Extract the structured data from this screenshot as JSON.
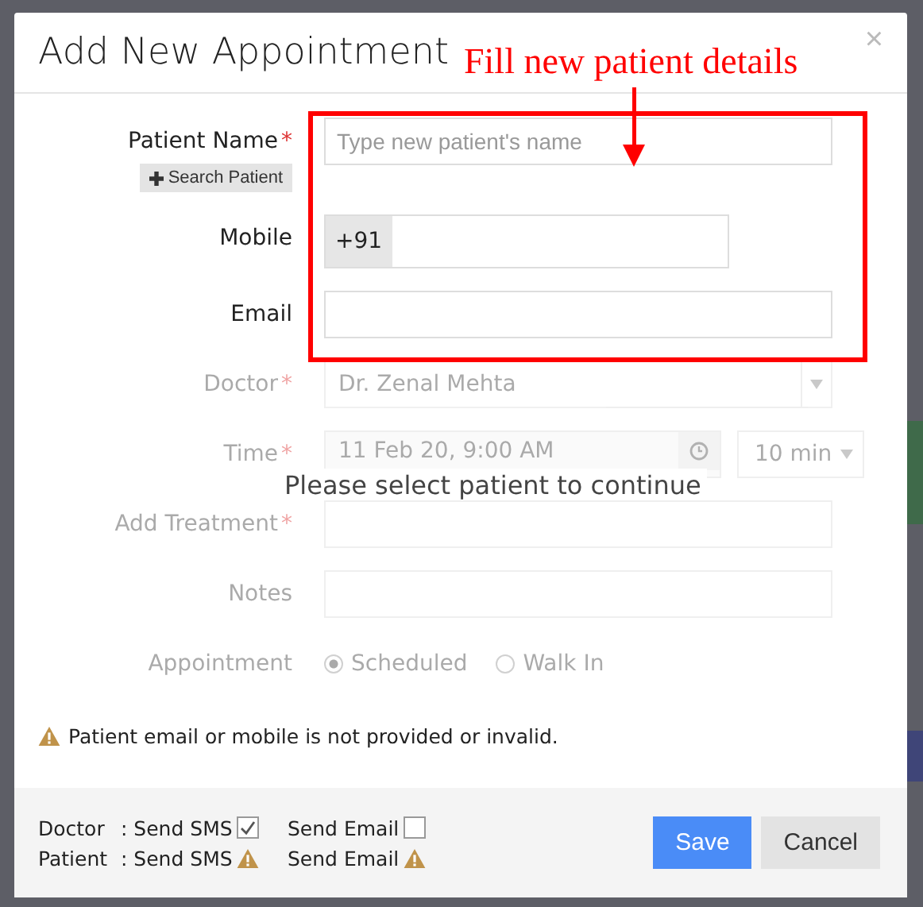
{
  "dialog": {
    "title": "Add New Appointment",
    "close": "×"
  },
  "annotation": {
    "text": "Fill new patient details"
  },
  "rows": [
    {
      "kind": "text",
      "label": "Patient Name",
      "required_mark": "*",
      "placeholder": "Type new patient's name",
      "disabled": false,
      "button": "Search Patient"
    },
    {
      "kind": "phone",
      "label": "Mobile",
      "prefix": "+91",
      "disabled": false
    },
    {
      "kind": "text",
      "label": "Email",
      "disabled": false
    },
    {
      "kind": "select",
      "label": "Doctor",
      "required_mark": "*",
      "value": "Dr. Zenal Mehta",
      "disabled": true
    },
    {
      "kind": "time",
      "label": "Time",
      "required_mark": "*",
      "value": "11 Feb 20, 9:00 AM",
      "duration": "10 min",
      "disabled": true
    },
    {
      "kind": "text",
      "label": "Add Treatment",
      "required_mark": "*",
      "disabled": true
    },
    {
      "kind": "text",
      "label": "Notes",
      "disabled": true
    },
    {
      "kind": "radio",
      "label": "Appointment",
      "disabled": true,
      "options": [
        {
          "label": "Scheduled",
          "selected": true
        },
        {
          "label": "Walk In",
          "selected": false
        }
      ]
    }
  ],
  "overlay_message": "Please select patient to continue",
  "warning": "Patient email or mobile is not provided or invalid.",
  "notify": [
    {
      "who": "Doctor",
      "items": [
        {
          "kind": "checkbox",
          "label": ": Send SMS",
          "checked": true
        },
        {
          "kind": "checkbox",
          "label": "Send Email",
          "checked": false
        }
      ]
    },
    {
      "who": "Patient",
      "items": [
        {
          "kind": "warning",
          "label": ": Send SMS"
        },
        {
          "kind": "warning",
          "label": "Send Email"
        }
      ]
    }
  ],
  "buttons": [
    {
      "kind": "primary",
      "label": "Save"
    },
    {
      "kind": "default",
      "label": "Cancel"
    }
  ]
}
